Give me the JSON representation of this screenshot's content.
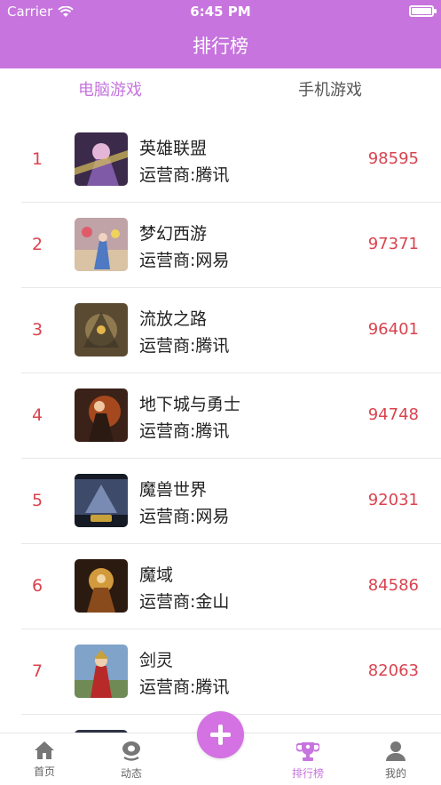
{
  "status_bar": {
    "carrier": "Carrier",
    "time": "6:45 PM",
    "battery_level": 1.0
  },
  "nav": {
    "title": "排行榜"
  },
  "tabs": [
    {
      "label": "电脑游戏",
      "active": true
    },
    {
      "label": "手机游戏",
      "active": false
    }
  ],
  "games": [
    {
      "rank": "1",
      "name": "英雄联盟",
      "operator": "运营商:腾讯",
      "score": "98595"
    },
    {
      "rank": "2",
      "name": "梦幻西游",
      "operator": "运营商:网易",
      "score": "97371"
    },
    {
      "rank": "3",
      "name": "流放之路",
      "operator": "运营商:腾讯",
      "score": "96401"
    },
    {
      "rank": "4",
      "name": "地下城与勇士",
      "operator": "运营商:腾讯",
      "score": "94748"
    },
    {
      "rank": "5",
      "name": "魔兽世界",
      "operator": "运营商:网易",
      "score": "92031"
    },
    {
      "rank": "6",
      "name": "魔域",
      "operator": "运营商:金山",
      "score": "84586"
    },
    {
      "rank": "7",
      "name": "剑灵",
      "operator": "运营商:腾讯",
      "score": "82063"
    }
  ],
  "tabbar": {
    "items": [
      {
        "label": "首页",
        "icon": "home-icon"
      },
      {
        "label": "动态",
        "icon": "location-icon"
      },
      {
        "label": "排行榜",
        "icon": "trophy-icon"
      },
      {
        "label": "我的",
        "icon": "person-icon"
      }
    ],
    "active": "排行榜",
    "center_button_icon": "plus-icon"
  },
  "colors": {
    "accent": "#c774de",
    "rank_red": "#d9434f"
  }
}
